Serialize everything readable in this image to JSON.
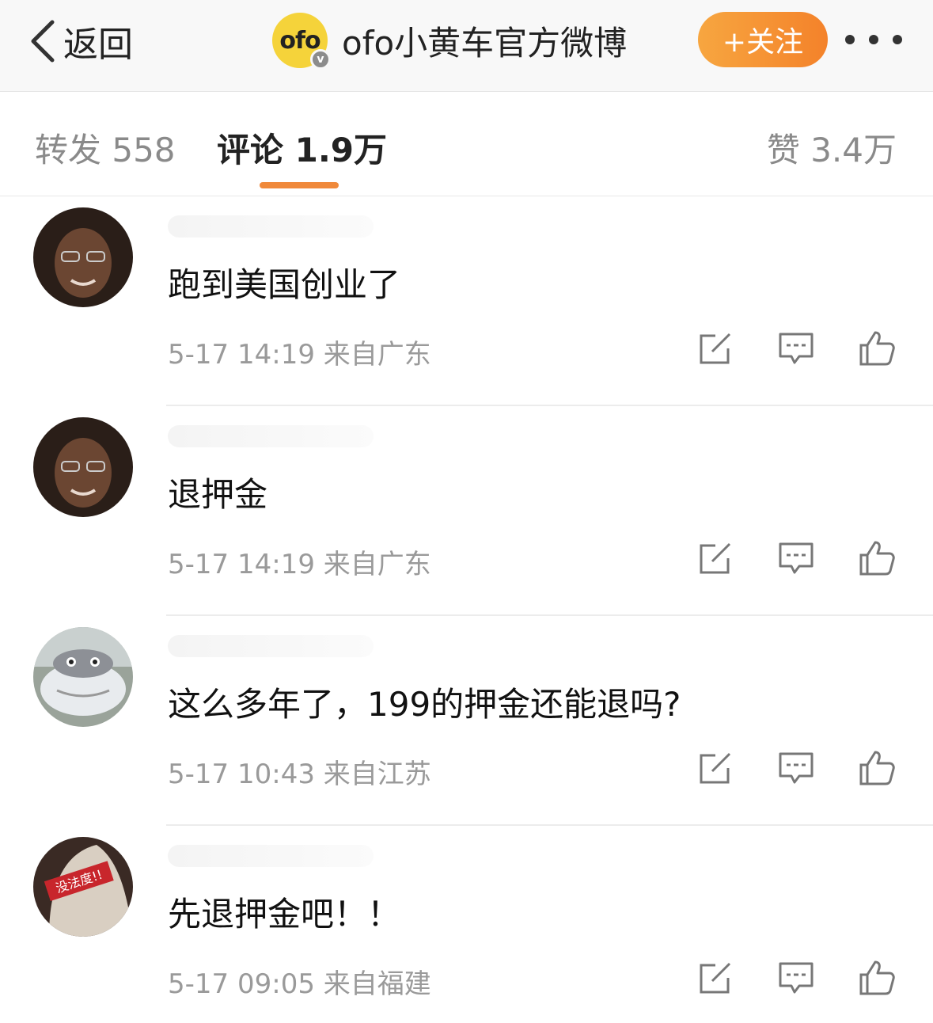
{
  "header": {
    "back_label": "返回",
    "logo_text": "ofo",
    "verified_badge": "v",
    "title": "ofo小黄车官方微博",
    "follow_label": "+关注",
    "more_icon": "more-icon"
  },
  "tabs": {
    "repost": "转发 558",
    "comment": "评论 1.9万",
    "like": "赞 3.4万",
    "active": "comment",
    "accent_color": "#f0893a"
  },
  "comments": [
    {
      "text": "跑到美国创业了",
      "meta": "5-17 14:19  来自广东"
    },
    {
      "text": "退押金",
      "meta": "5-17 14:19  来自广东"
    },
    {
      "text": "这么多年了，199的押金还能退吗?",
      "meta": "5-17 10:43  来自江苏"
    },
    {
      "text": "先退押金吧！！",
      "meta": "5-17 09:05  来自福建"
    }
  ],
  "avatar_badge_text": "没法度!!",
  "icons": [
    "back-chevron-icon",
    "verified-icon",
    "more-icon",
    "share-icon",
    "reply-icon",
    "like-icon"
  ]
}
